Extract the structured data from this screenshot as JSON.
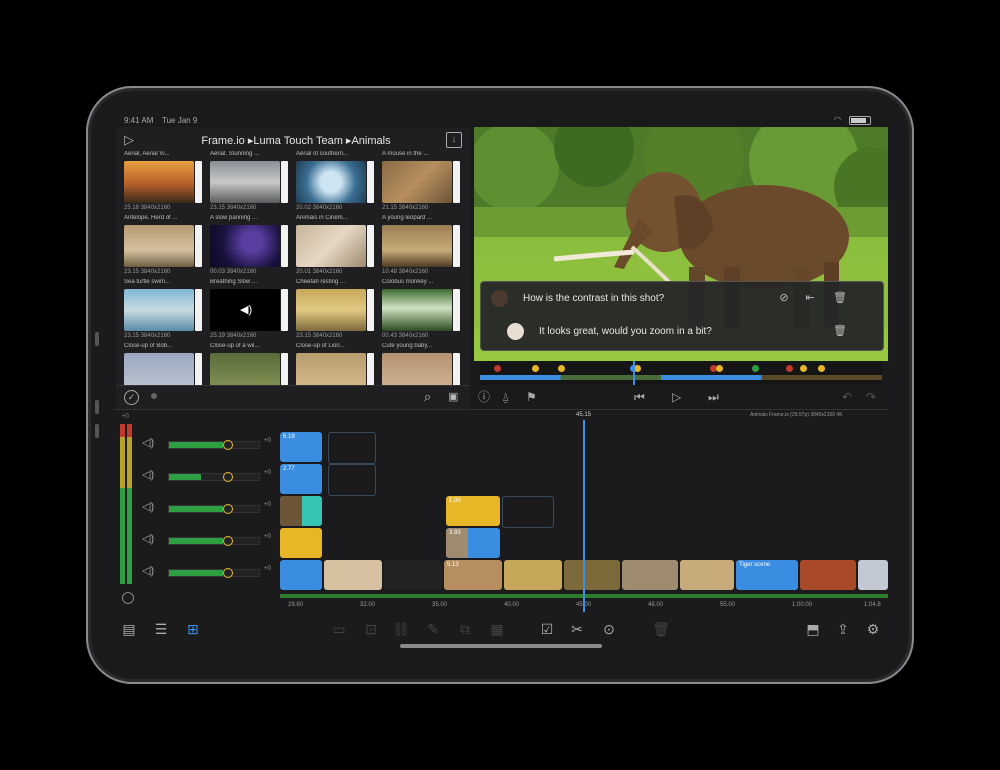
{
  "status_bar": {
    "time": "9:41 AM",
    "date": "Tue Jan 9"
  },
  "browser": {
    "path": "Frame.io ▸Luma Touch Team ▸Animals",
    "clips": [
      {
        "caption": "Aerial, Aerial Vi...",
        "meta": "25.18 3840x2160",
        "thumb": "sunset"
      },
      {
        "caption": "Aerial, Stunning ...",
        "meta": "23.15 3840x2160",
        "thumb": "mist"
      },
      {
        "caption": "Aerial of southern...",
        "meta": "20.02 3840x2160",
        "thumb": "water"
      },
      {
        "caption": "A mouse in the ...",
        "meta": "21.15 3840x2160",
        "thumb": "deer"
      },
      {
        "caption": "Antelope, Herd of ...",
        "meta": "23.15 3840x2160",
        "thumb": "antelope"
      },
      {
        "caption": "A slow panning ...",
        "meta": "00.03 3840x2160",
        "thumb": "stars"
      },
      {
        "caption": "Animals in Cinem...",
        "meta": "20.01 3840x2160",
        "thumb": "lion"
      },
      {
        "caption": "A young leopard ...",
        "meta": "10.48 3840x2160",
        "thumb": "cat"
      },
      {
        "caption": "Sea turtle swim...",
        "meta": "23.15 3840x2160",
        "thumb": "turtle"
      },
      {
        "caption": "Breathing Slow ...",
        "meta": "25.19 3840x2160",
        "thumb": "audio"
      },
      {
        "caption": "Cheetah resting ...",
        "meta": "23.15 3840x2160",
        "thumb": "cheetah"
      },
      {
        "caption": "Colobus monkey ...",
        "meta": "00.43 3840x2160",
        "thumb": "monkey"
      },
      {
        "caption": "Close-up of Bob...",
        "meta": "",
        "thumb": "bobcat"
      },
      {
        "caption": "Close-up of a wil...",
        "meta": "",
        "thumb": "wild"
      },
      {
        "caption": "Close-up of Lion...",
        "meta": "",
        "thumb": "lion2"
      },
      {
        "caption": "Cute young baby...",
        "meta": "",
        "thumb": "baby"
      }
    ]
  },
  "comments": [
    {
      "text": "How is the contrast in this shot?"
    },
    {
      "text": "It looks great, would you zoom in a bit?"
    }
  ],
  "timeline": {
    "playhead_time": "45.15",
    "info": "Animals Frame.io (29.97p) 3840x2160 4K",
    "ruler": [
      "29.60",
      "32.00",
      "35.00",
      "40.00",
      "45.00",
      "48.00",
      "55.00",
      "1:00.00",
      "1:04.8"
    ],
    "gain_labels": [
      "+0",
      "+0",
      "+0",
      "+0",
      "+0"
    ],
    "clip_labels": {
      "c1": "6.19",
      "c2": "2.77",
      "c3": "1.00",
      "c4": "3.93",
      "c5": "5.13",
      "c6": "Tiger scene"
    }
  },
  "colors": {
    "accent": "#3d8ee6",
    "clip_blue": "#3a8de0",
    "clip_yellow": "#e8b727",
    "clip_teal": "#36c5b5"
  }
}
